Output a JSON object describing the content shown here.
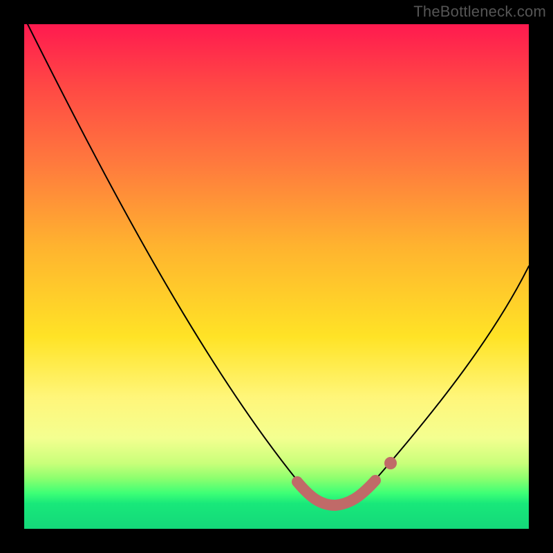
{
  "watermark": "TheBottleneck.com",
  "chart_data": {
    "type": "line",
    "title": "",
    "xlabel": "",
    "ylabel": "",
    "xlim": [
      0,
      100
    ],
    "ylim": [
      0,
      100
    ],
    "grid": false,
    "legend": null,
    "series": [
      {
        "name": "bottleneck-curve",
        "x": [
          0,
          10,
          20,
          30,
          40,
          50,
          56,
          60,
          64,
          70,
          80,
          90,
          100
        ],
        "values": [
          100,
          85,
          69,
          53,
          37,
          21,
          11,
          6,
          5,
          7,
          17,
          34,
          53
        ]
      }
    ],
    "optimal_band": {
      "x_start": 55,
      "x_end": 70
    },
    "marker": {
      "x": 72
    },
    "background_bands": {
      "type": "vertical-gradient",
      "stops": [
        {
          "pos": 0.0,
          "color": "#ff1a4f"
        },
        {
          "pos": 0.62,
          "color": "#ffe326"
        },
        {
          "pos": 0.93,
          "color": "#3cff76"
        },
        {
          "pos": 1.0,
          "color": "#14d87a"
        }
      ]
    }
  }
}
